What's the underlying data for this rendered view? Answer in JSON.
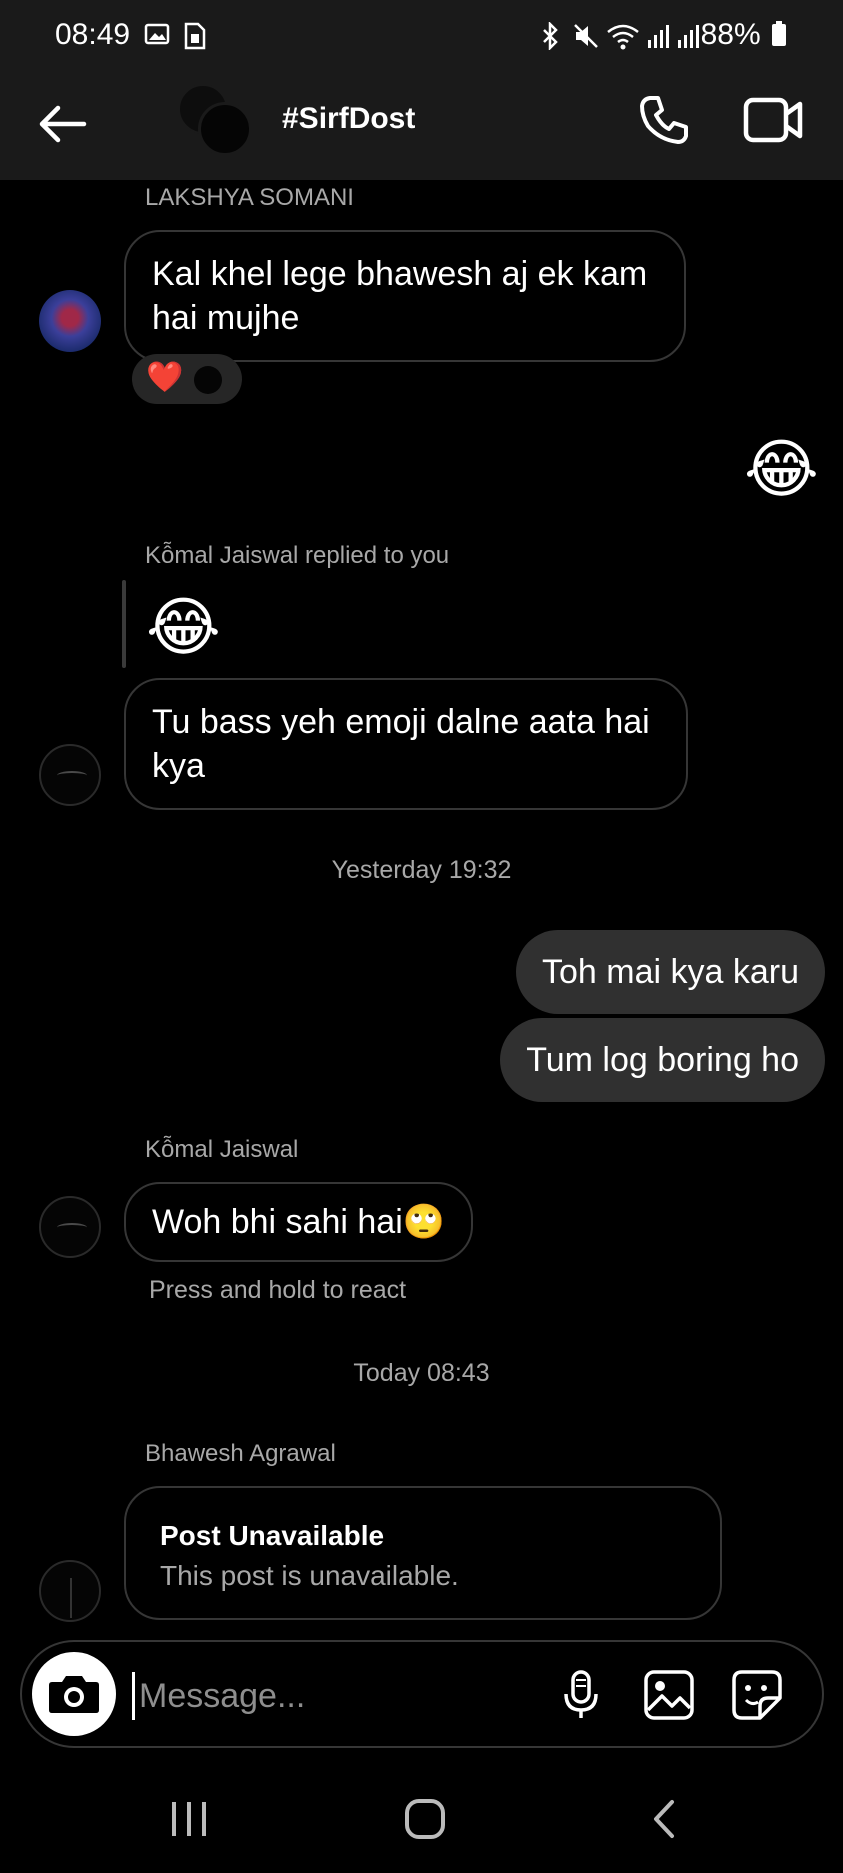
{
  "status_bar": {
    "time": "08:49",
    "battery": "88%"
  },
  "header": {
    "title": "#SirfDost"
  },
  "messages": [
    {
      "sender": "LAKSHYA SOMANI",
      "text": "Kal khel lege bhawesh aj ek kam hai mujhe",
      "reaction": "❤️"
    },
    {
      "outgoing_emoji": "😂"
    },
    {
      "reply_label": "Kỗmal Jaiswal replied to you",
      "quoted": "😂",
      "text": "Tu bass yeh emoji dalne aata hai kya"
    },
    {
      "timestamp": "Yesterday 19:32"
    },
    {
      "outgoing": [
        "Toh mai kya karu",
        "Tum log boring ho"
      ]
    },
    {
      "sender": "Kỗmal Jaiswal",
      "text": "Woh bhi sahi hai🙄",
      "hint": "Press and hold to react"
    },
    {
      "timestamp": "Today 08:43"
    },
    {
      "sender": "Bhawesh Agrawal",
      "post_title": "Post Unavailable",
      "post_subtitle": "This post is unavailable."
    }
  ],
  "composer": {
    "placeholder": "Message..."
  }
}
